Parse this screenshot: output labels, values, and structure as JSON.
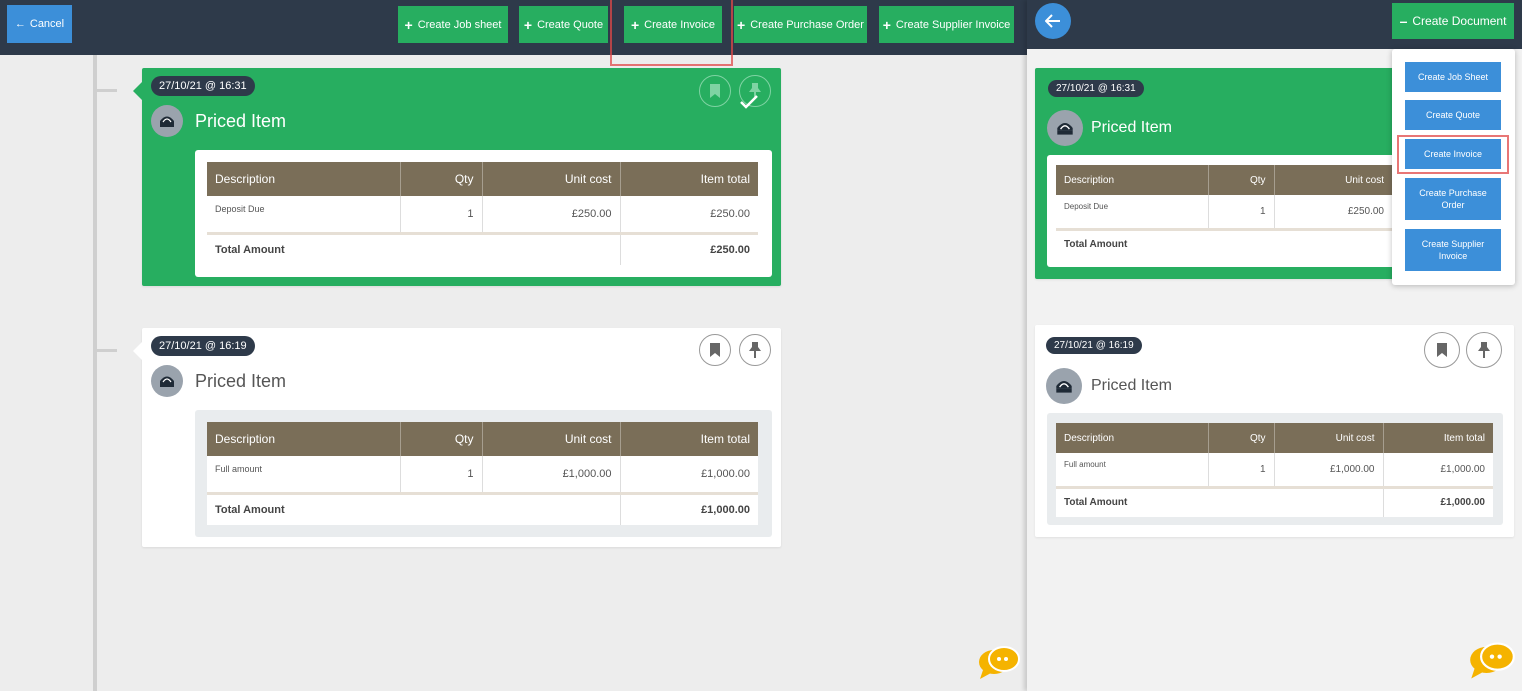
{
  "left": {
    "cancel_label": "Cancel",
    "toolbar": [
      {
        "label": "Create Job sheet"
      },
      {
        "label": "Create Quote"
      },
      {
        "label": "Create Invoice"
      },
      {
        "label": "Create Purchase Order"
      },
      {
        "label": "Create Supplier Invoice"
      }
    ],
    "cards": [
      {
        "date": "27/10/21 @ 16:31",
        "title": "Priced Item",
        "headers": [
          "Description",
          "Qty",
          "Unit cost",
          "Item total"
        ],
        "row": {
          "description": "Deposit Due",
          "qty": "1",
          "unit_cost": "£250.00",
          "item_total": "£250.00"
        },
        "total_label": "Total Amount",
        "total_value": "£250.00"
      },
      {
        "date": "27/10/21 @ 16:19",
        "title": "Priced Item",
        "headers": [
          "Description",
          "Qty",
          "Unit cost",
          "Item total"
        ],
        "row": {
          "description": "Full amount",
          "qty": "1",
          "unit_cost": "£1,000.00",
          "item_total": "£1,000.00"
        },
        "total_label": "Total Amount",
        "total_value": "£1,000.00"
      }
    ]
  },
  "right": {
    "create_document_label": "Create Document",
    "menu": [
      {
        "label": "Create Job Sheet"
      },
      {
        "label": "Create Quote"
      },
      {
        "label": "Create Invoice"
      },
      {
        "label": "Create Purchase Order"
      },
      {
        "label": "Create Supplier Invoice"
      }
    ],
    "cards": [
      {
        "date": "27/10/21 @ 16:31",
        "title": "Priced Item",
        "headers": [
          "Description",
          "Qty",
          "Unit cost"
        ],
        "row": {
          "description": "Deposit Due",
          "qty": "1",
          "unit_cost": "£250.00"
        },
        "total_label": "Total Amount"
      },
      {
        "date": "27/10/21 @ 16:19",
        "title": "Priced Item",
        "headers": [
          "Description",
          "Qty",
          "Unit cost",
          "Item total"
        ],
        "row": {
          "description": "Full amount",
          "qty": "1",
          "unit_cost": "£1,000.00",
          "item_total": "£1,000.00"
        },
        "total_label": "Total Amount",
        "total_value": "£1,000.00"
      }
    ]
  },
  "colors": {
    "topbar": "#2e3a4a",
    "green": "#27ae60",
    "blue": "#3c8fd9",
    "table_header": "#7a6e58",
    "highlight": "#e04848",
    "chat": "#f5b300"
  },
  "icons": [
    "arrow-left-icon",
    "plus-icon",
    "minus-icon",
    "bookmark-icon",
    "pin-icon",
    "checkmark-icon",
    "user-avatar-icon",
    "chat-bubbles-icon"
  ]
}
